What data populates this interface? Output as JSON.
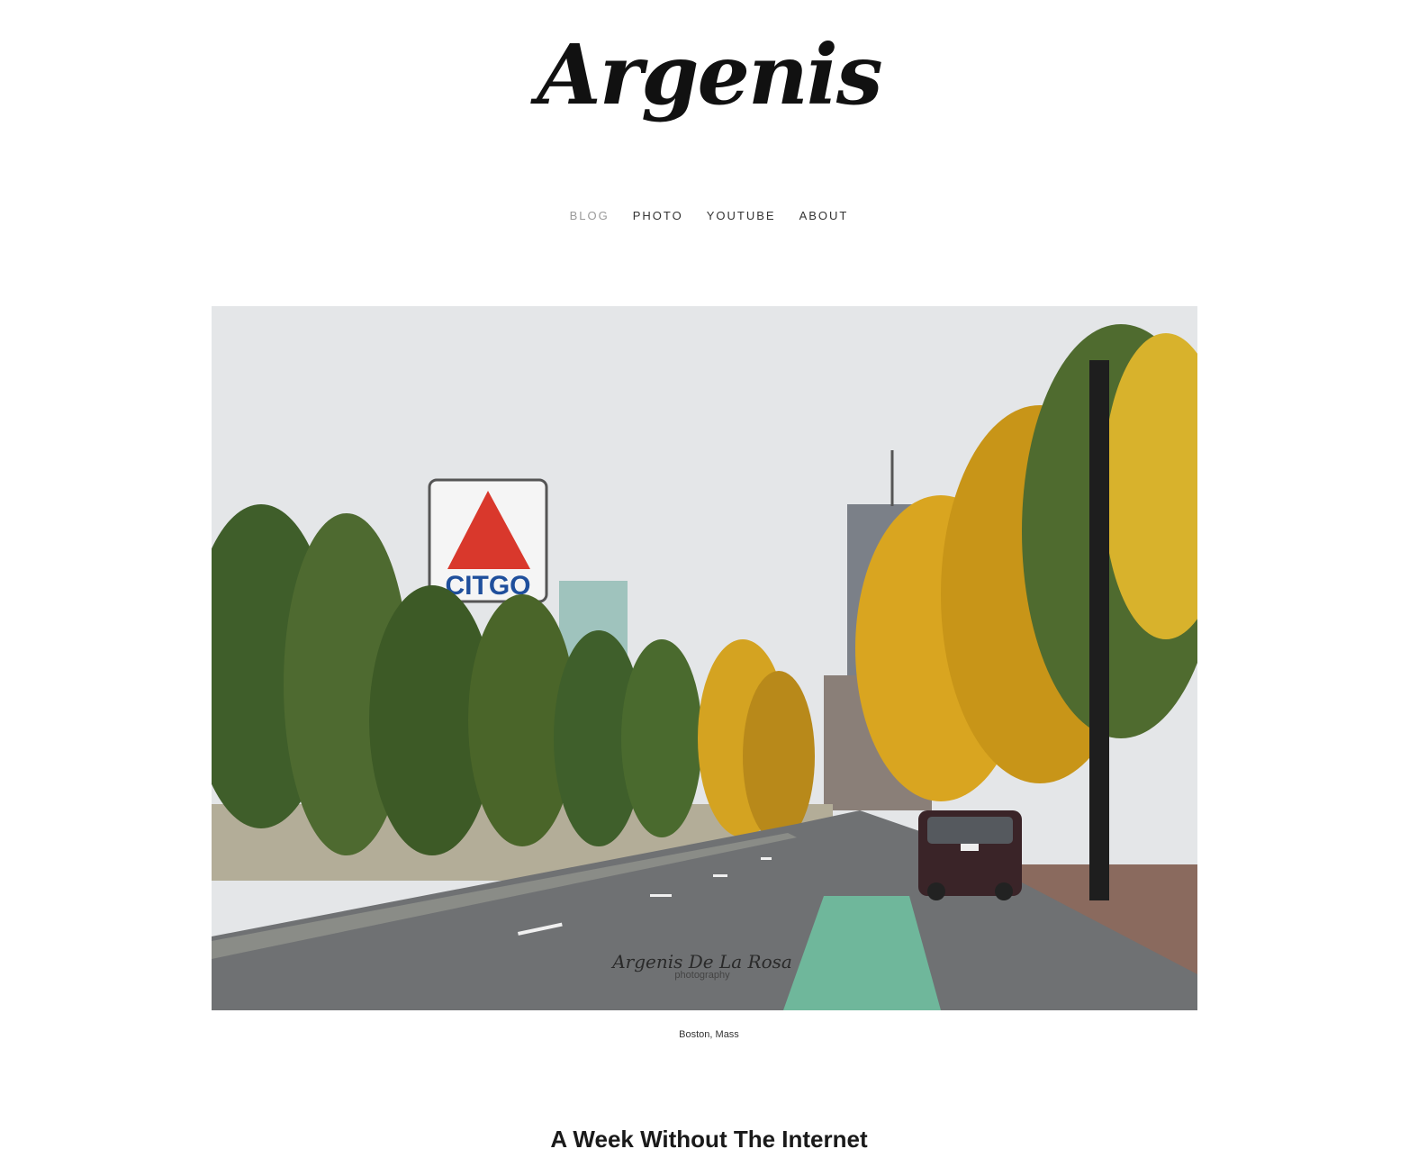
{
  "site": {
    "logo": "Argenis"
  },
  "nav": {
    "items": [
      {
        "label": "BLOG",
        "active": true
      },
      {
        "label": "PHOTO",
        "active": false
      },
      {
        "label": "YOUTUBE",
        "active": false
      },
      {
        "label": "ABOUT",
        "active": false
      }
    ]
  },
  "hero": {
    "sign_text": "CITGO",
    "watermark_name": "Argenis De La Rosa",
    "watermark_sub": "photography",
    "caption": "Boston, Mass"
  },
  "post": {
    "title": "A Week Without The Internet"
  },
  "colors": {
    "sign_red": "#d9382c",
    "sign_blue": "#1f4f9c",
    "bike_lane": "#6fb79b",
    "foliage_gold": "#d9a520",
    "foliage_green": "#4f6b2f"
  }
}
